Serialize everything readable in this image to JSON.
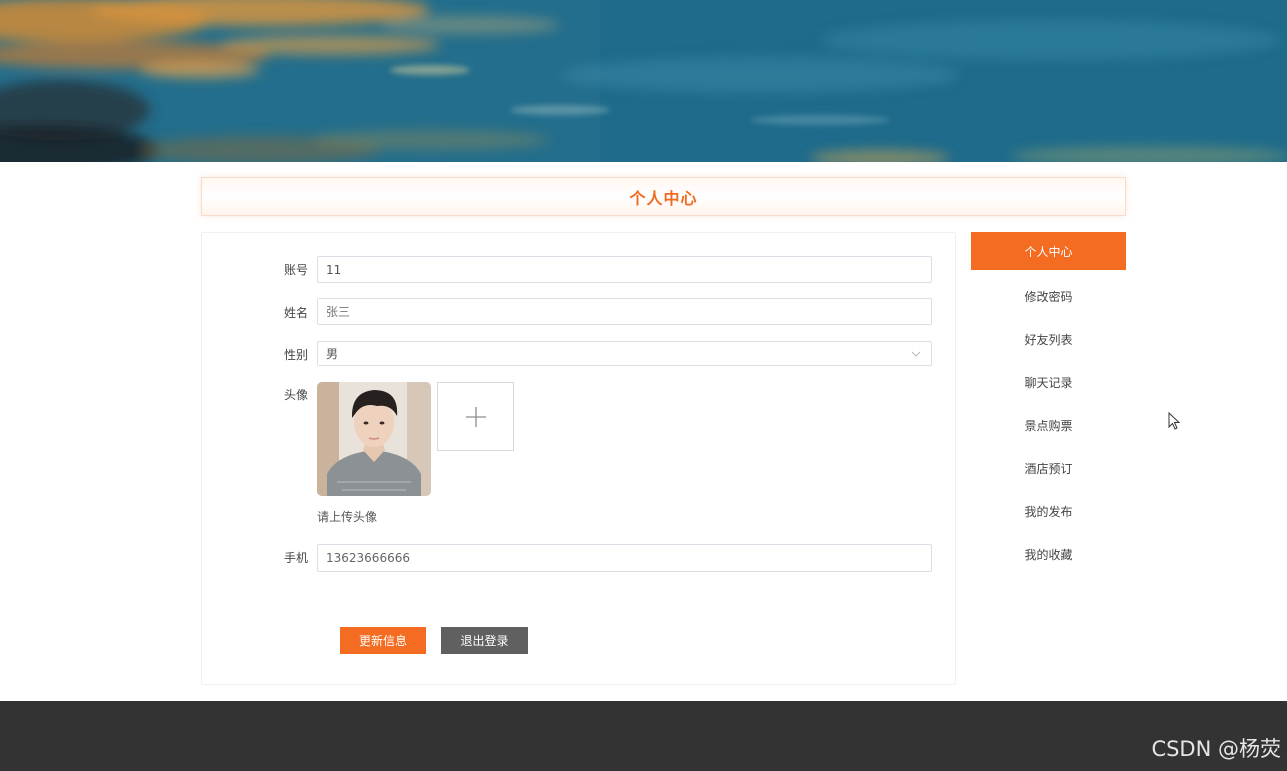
{
  "header": {
    "page_title": "个人中心"
  },
  "form": {
    "account": {
      "label": "账号",
      "value": "11"
    },
    "name": {
      "label": "姓名",
      "value": "张三"
    },
    "gender": {
      "label": "性别",
      "value": "男"
    },
    "avatar": {
      "label": "头像",
      "upload_hint": "请上传头像"
    },
    "phone": {
      "label": "手机",
      "value": "13623666666"
    },
    "update_button": "更新信息",
    "logout_button": "退出登录"
  },
  "sidebar": {
    "items": [
      {
        "label": "个人中心",
        "active": true
      },
      {
        "label": "修改密码",
        "active": false
      },
      {
        "label": "好友列表",
        "active": false
      },
      {
        "label": "聊天记录",
        "active": false
      },
      {
        "label": "景点购票",
        "active": false
      },
      {
        "label": "酒店预订",
        "active": false
      },
      {
        "label": "我的发布",
        "active": false
      },
      {
        "label": "我的收藏",
        "active": false
      }
    ]
  },
  "watermark": "CSDN @杨荧",
  "colors": {
    "accent": "#f36c21",
    "logout": "#606060",
    "footer": "#333333"
  },
  "icons": {
    "upload": "plus-icon",
    "select": "chevron-down-icon",
    "cursor": "mouse-pointer-icon"
  }
}
